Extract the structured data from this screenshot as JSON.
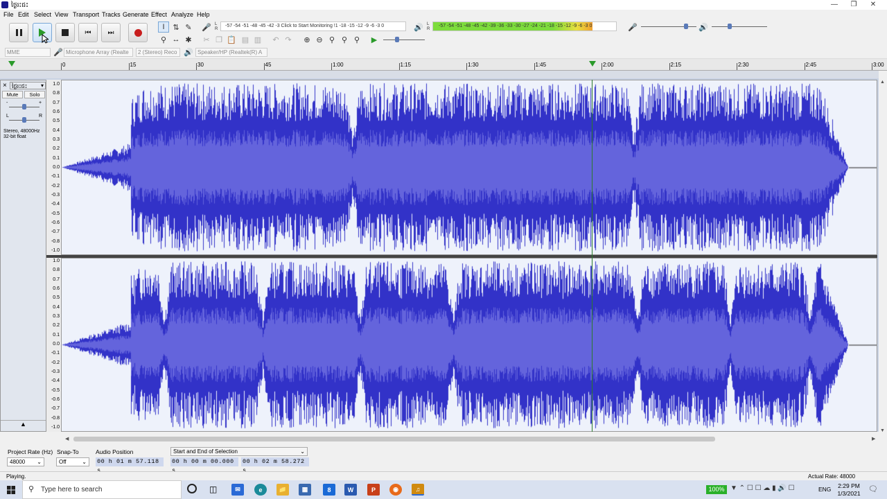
{
  "window": {
    "title": "ថ្ងៃរះជះ"
  },
  "menu": [
    "File",
    "Edit",
    "Select",
    "View",
    "Transport",
    "Tracks",
    "Generate",
    "Effect",
    "Analyze",
    "Help"
  ],
  "meters": {
    "record_scale": "-57 -54 -51 -48 -45 -42 -3 Click to Start Monitoring !1 -18 -15 -12 -9 -6 -3 0",
    "play_scale": "-57 -54 -51 -48 -45 -42 -39 -36 -33 -30 -27 -24 -21 -18 -15 -12 -9 -6 -3 0",
    "record_level": 0.0,
    "play_level": 0.87
  },
  "devices": {
    "host": "MME",
    "recording_device": "Microphone Array (Realte",
    "channels": "2 (Stereo) Reco",
    "playback_device": "Speaker/HP (Realtek(R) A"
  },
  "timeline": {
    "labels": [
      "0",
      "15",
      "30",
      "45",
      "1:00",
      "1:15",
      "1:30",
      "1:45",
      "2:00",
      "2:15",
      "2:30",
      "2:45",
      "3:00"
    ],
    "playhead": "1:57"
  },
  "track": {
    "name": "ថ្ងៃរះជះ",
    "mute_label": "Mute",
    "solo_label": "Solo",
    "gain_minus": "-",
    "gain_plus": "+",
    "pan_left": "L",
    "pan_right": "R",
    "info_line1": "Stereo, 48000Hz",
    "info_line2": "32-bit float",
    "scale": [
      "1.0",
      "0.8",
      "0.7",
      "0.6",
      "0.5",
      "0.4",
      "0.3",
      "0.2",
      "0.1",
      "0.0",
      "-0.1",
      "-0.2",
      "-0.3",
      "-0.4",
      "-0.5",
      "-0.6",
      "-0.7",
      "-0.8",
      "-1.0"
    ]
  },
  "selection_toolbar": {
    "project_rate_label": "Project Rate (Hz)",
    "project_rate_value": "48000",
    "snap_label": "Snap-To",
    "snap_value": "Off",
    "audio_position_label": "Audio Position",
    "audio_position_value": "00 h 01 m 57.118 s",
    "selection_mode": "Start and End of Selection",
    "selection_start": "00 h 00 m 00.000 s",
    "selection_end": "00 h 02 m 58.272 s"
  },
  "status": {
    "left": "Playing.",
    "right": "Actual Rate: 48000"
  },
  "taskbar": {
    "search_placeholder": "Type here to search",
    "battery": "100%",
    "lang": "ENG",
    "time": "2:29 PM",
    "date": "1/3/2021"
  },
  "colors": {
    "wave": "#3232c8",
    "wave_rms": "#6464dc",
    "wave_bg": "#eef2fb",
    "meter_green": "#7ddc3c",
    "meter_yellow": "#e8e040"
  }
}
